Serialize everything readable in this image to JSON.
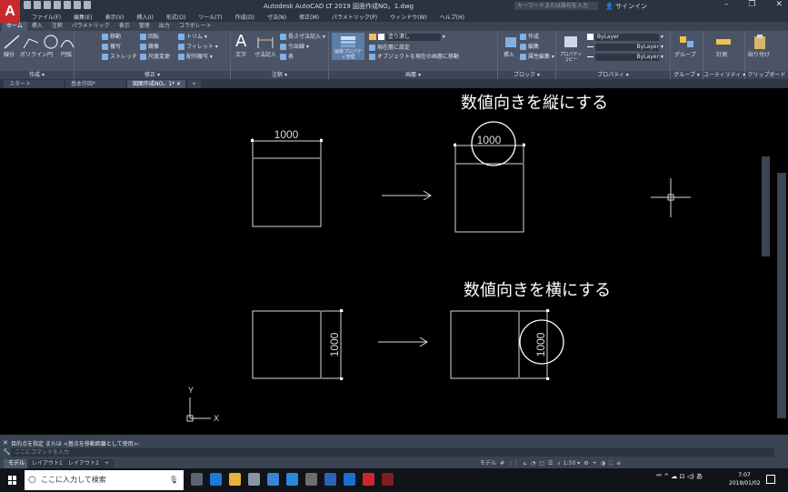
{
  "titlebar": {
    "logo_letter": "A",
    "title": "Autodesk AutoCAD LT 2019   図面作成NO。1.dwg",
    "search_placeholder": "キーワードまたは語句を入力",
    "signin": "サインイン",
    "minimize": "–",
    "restore": "❐",
    "close": "✕"
  },
  "menubar": {
    "items": [
      "ファイル(F)",
      "編集(E)",
      "表示(V)",
      "挿入(I)",
      "形式(O)",
      "ツール(T)",
      "作成(D)",
      "寸法(N)",
      "修正(M)",
      "パラメトリック(P)",
      "ウィンドウ(W)",
      "ヘルプ(H)"
    ]
  },
  "ribbon_tabs": {
    "items": [
      "ホーム",
      "挿入",
      "注釈",
      "パラメトリック",
      "表示",
      "管理",
      "出力",
      "コラボレート"
    ],
    "active": "ホーム"
  },
  "ribbon": {
    "draw": {
      "title": "作成 ▾",
      "line": "線分",
      "polyline": "ポリライン",
      "circle": "円",
      "arc": "円弧"
    },
    "modify": {
      "title": "修正 ▾",
      "move": "移動",
      "rotate": "回転",
      "trim": "トリム ▾",
      "copy": "複写",
      "mirror": "鏡像",
      "fillet": "フィレット ▾",
      "stretch": "ストレッチ",
      "scale": "尺度変更",
      "array": "配列複写 ▾"
    },
    "annotation": {
      "title": "注釈 ▾",
      "text": "文字",
      "dimension": "寸法記入",
      "linear": "長さ寸法記入 ▾",
      "leader": "引出線 ▾",
      "table": "表"
    },
    "layers": {
      "title": "画層 ▾",
      "layer_props": "画層プロパティ管理",
      "current": "現在層に設定",
      "match": "オブジェクトを現在の画層に移動",
      "layer_name": "塗り潰し"
    },
    "block": {
      "title": "ブロック ▾",
      "insert": "挿入",
      "create": "作成",
      "edit": "編集",
      "attr": "属性編集 ▾"
    },
    "properties": {
      "title": "プロパティ ▾",
      "match": "プロパティコピー",
      "bylayer1": "ByLayer",
      "bylayer2": "ByLayer",
      "bylayer3": "ByLayer"
    },
    "groups": {
      "title": "グループ ▾",
      "group": "グループ"
    },
    "utilities": {
      "title": "ユーティリティ ▾",
      "measure": "計測"
    },
    "clipboard": {
      "title": "クリップボード",
      "paste": "貼り付け"
    }
  },
  "file_tabs": {
    "start": "スタート",
    "doc1": "基本作図*",
    "doc2": "図面作成NO。1*",
    "close": "✕",
    "add": "+"
  },
  "canvas": {
    "caption_top": "数値向きを縦にする",
    "caption_bottom": "数値向きを横にする",
    "dim_value": "1000",
    "ucs_x": "X",
    "ucs_y": "Y"
  },
  "command": {
    "history": "目的点を指定 または <基点を移動距離として使用>:",
    "placeholder": "ここにコマンドを入力"
  },
  "layout_tabs": {
    "items": [
      "モデル",
      "レイアウト1",
      "レイアウト2"
    ],
    "active": "モデル",
    "add": "+"
  },
  "statusbar": {
    "model": "モデル",
    "grid": "#",
    "scale": "1:50 ▾"
  },
  "taskbar": {
    "search_placeholder": "ここに入力して検索",
    "tray": "ᴬᴿ  ^  ☁  ⊡  ◁)  あ",
    "time": "7:07",
    "date": "2019/01/02"
  }
}
